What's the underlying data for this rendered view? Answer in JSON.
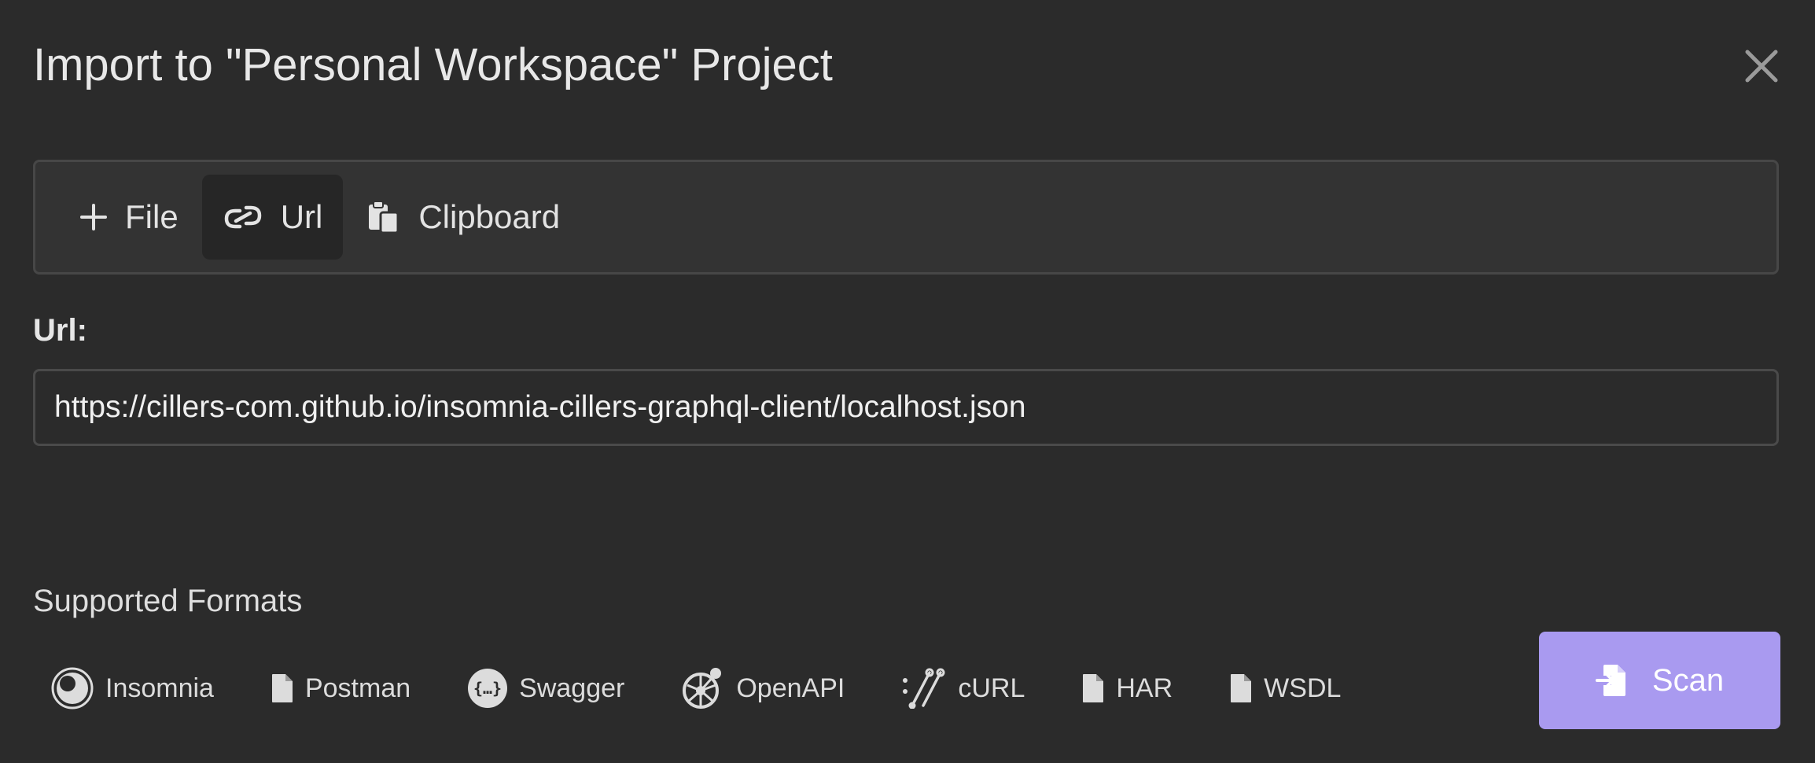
{
  "dialog": {
    "title": "Import to \"Personal Workspace\" Project",
    "close_icon": "close-icon"
  },
  "tabs": [
    {
      "label": "File",
      "icon": "plus-icon",
      "active": false
    },
    {
      "label": "Url",
      "icon": "link-icon",
      "active": true
    },
    {
      "label": "Clipboard",
      "icon": "clipboard-icon",
      "active": false
    }
  ],
  "url_field": {
    "label": "Url:",
    "value": "https://cillers-com.github.io/insomnia-cillers-graphql-client/localhost.json"
  },
  "supported_formats": {
    "title": "Supported Formats",
    "items": [
      {
        "label": "Insomnia",
        "icon": "insomnia-icon"
      },
      {
        "label": "Postman",
        "icon": "file-icon"
      },
      {
        "label": "Swagger",
        "icon": "swagger-icon"
      },
      {
        "label": "OpenAPI",
        "icon": "openapi-icon"
      },
      {
        "label": "cURL",
        "icon": "curl-icon"
      },
      {
        "label": "HAR",
        "icon": "file-icon"
      },
      {
        "label": "WSDL",
        "icon": "file-icon"
      }
    ]
  },
  "scan_button": {
    "label": "Scan",
    "icon": "file-import-icon"
  },
  "colors": {
    "background": "#2b2b2b",
    "accent": "#a99af0",
    "active_tab": "#262626"
  }
}
